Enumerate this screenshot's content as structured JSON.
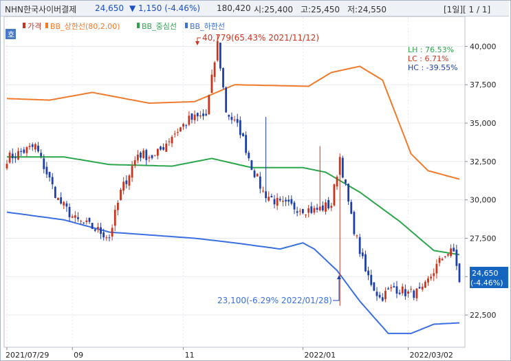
{
  "header": {
    "stock_name": "NHN한국사이버결제",
    "price": "24,650",
    "change": "▼ 1,150 (-4.46%)",
    "volume": "180,420",
    "open": "시:25,400",
    "high": "고:25,450",
    "low": "저:24,550",
    "page_label": "[1일][ 1 / 1]"
  },
  "legend": {
    "price": "가격",
    "upper": "BB_상한선(80,2.00)",
    "middle": "BB_중심선",
    "lower": "BB_하한선",
    "badge": "호"
  },
  "stats": {
    "lh": "LH :  76.53%",
    "lc": "LC :   6.71%",
    "hc": "HC : -39.55%"
  },
  "annotations": {
    "high": "40,779(65.43% 2021/11/12)",
    "low": "23,100(-6.29% 2022/01/28)"
  },
  "last_price_box": {
    "price": "24,650",
    "change": "(-4.46%)"
  },
  "colors": {
    "up": "#c8341e",
    "down": "#1e3fa8",
    "upper_band": "#f07a2a",
    "middle_band": "#2aa54a",
    "lower_band": "#3a6fe0",
    "price_box": "#1565c0"
  },
  "chart_data": {
    "type": "candlestick",
    "title": "",
    "xlabel": "",
    "ylabel": "",
    "x_tick_labels": [
      "2021/07/29",
      "09",
      "11",
      "2022/01",
      "2022/03/02"
    ],
    "y_tick_labels": [
      "22,500",
      "25,000",
      "27,500",
      "30,000",
      "32,500",
      "35,000",
      "37,500",
      "40,000"
    ],
    "ylim": [
      20400,
      41900
    ],
    "grid": true,
    "num_bars": 160,
    "close_anchors": [
      [
        0,
        32700
      ],
      [
        10,
        33500
      ],
      [
        18,
        30000
      ],
      [
        24,
        28700
      ],
      [
        30,
        28200
      ],
      [
        36,
        27600
      ],
      [
        40,
        30500
      ],
      [
        46,
        33000
      ],
      [
        52,
        32800
      ],
      [
        58,
        34200
      ],
      [
        64,
        35200
      ],
      [
        70,
        35500
      ],
      [
        74,
        40200
      ],
      [
        77,
        35800
      ],
      [
        82,
        34500
      ],
      [
        86,
        32200
      ],
      [
        90,
        30500
      ],
      [
        96,
        29700
      ],
      [
        102,
        29500
      ],
      [
        108,
        29300
      ],
      [
        114,
        29700
      ],
      [
        117,
        32800
      ],
      [
        121,
        28800
      ],
      [
        126,
        25300
      ],
      [
        131,
        23600
      ],
      [
        136,
        24300
      ],
      [
        141,
        23900
      ],
      [
        146,
        24000
      ],
      [
        150,
        25400
      ],
      [
        154,
        26500
      ],
      [
        157,
        26600
      ],
      [
        158,
        25800
      ],
      [
        159,
        24650
      ]
    ],
    "high_events": [
      {
        "index": 74,
        "value": 40779
      },
      {
        "index": 91,
        "value": 35400
      },
      {
        "index": 110,
        "value": 33500
      }
    ],
    "low_events": [
      {
        "index": 117,
        "value": 23100
      }
    ],
    "upper_band_anchors": [
      [
        0,
        36600
      ],
      [
        15,
        36500
      ],
      [
        30,
        37000
      ],
      [
        50,
        36300
      ],
      [
        66,
        36400
      ],
      [
        80,
        37500
      ],
      [
        106,
        37400
      ],
      [
        114,
        38300
      ],
      [
        124,
        38700
      ],
      [
        132,
        37800
      ],
      [
        142,
        33000
      ],
      [
        148,
        31900
      ],
      [
        160,
        31300
      ]
    ],
    "middle_band_anchors": [
      [
        0,
        32800
      ],
      [
        20,
        32800
      ],
      [
        36,
        32300
      ],
      [
        58,
        32200
      ],
      [
        72,
        32700
      ],
      [
        86,
        32100
      ],
      [
        104,
        32100
      ],
      [
        112,
        31800
      ],
      [
        124,
        30500
      ],
      [
        138,
        28600
      ],
      [
        150,
        26700
      ],
      [
        160,
        26400
      ]
    ],
    "lower_band_anchors": [
      [
        0,
        29200
      ],
      [
        20,
        28700
      ],
      [
        36,
        27900
      ],
      [
        66,
        27500
      ],
      [
        80,
        27200
      ],
      [
        96,
        26800
      ],
      [
        104,
        27200
      ],
      [
        108,
        26800
      ],
      [
        116,
        25400
      ],
      [
        124,
        23400
      ],
      [
        134,
        21300
      ],
      [
        142,
        21300
      ],
      [
        150,
        21900
      ],
      [
        160,
        22000
      ]
    ],
    "series": [
      {
        "name": "가격",
        "type": "candlestick"
      },
      {
        "name": "BB_상한선(80,2.00)",
        "type": "line"
      },
      {
        "name": "BB_중심선",
        "type": "line"
      },
      {
        "name": "BB_하한선",
        "type": "line"
      }
    ]
  }
}
